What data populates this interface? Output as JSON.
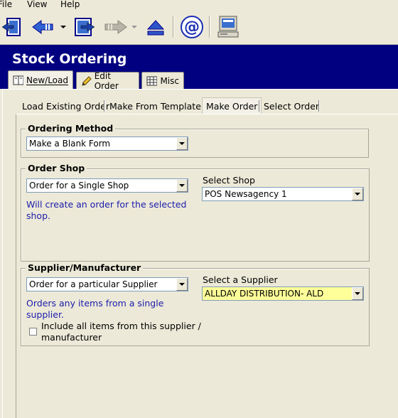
{
  "menu": {
    "file": "File",
    "view": "View",
    "help": "Help"
  },
  "toolbar": {
    "buttons": [
      "exit-icon",
      "back-icon",
      "dropdown-arrow",
      "import-icon",
      "forward-icon",
      "dropdown-arrow",
      "eject-icon",
      "email-icon",
      "computer-icon"
    ]
  },
  "header": {
    "title": "Stock Ordering"
  },
  "outer_tabs": [
    {
      "label": "New/Load",
      "icon": "book-icon",
      "active": true
    },
    {
      "label": "Edit Order",
      "icon": "pencil-icon",
      "active": false
    },
    {
      "label": "Misc",
      "icon": "grid-icon",
      "active": false
    }
  ],
  "sub_tabs": [
    {
      "label": "Load Existing Order",
      "active": false
    },
    {
      "label": "Make From Template",
      "active": false
    },
    {
      "label": "Make Order",
      "active": true
    },
    {
      "label": "Select Order",
      "active": false
    }
  ],
  "ordering_method": {
    "title": "Ordering Method",
    "value": "Make a Blank Form"
  },
  "order_shop": {
    "title": "Order Shop",
    "mode_value": "Order for a Single Shop",
    "hint_line1": "Will create an order for the selected",
    "hint_line2": "shop.",
    "select_label": "Select Shop",
    "shop_value": "POS Newsagency 1"
  },
  "supplier": {
    "title": "Supplier/Manufacturer",
    "mode_value": "Order for a particular Supplier",
    "hint_line1": "Orders any items from a single",
    "hint_line2": "supplier.",
    "select_label": "Select a Supplier",
    "supplier_value": "ALLDAY DISTRIBUTION- ALD",
    "include_all_line1": "Include all items from this supplier /",
    "include_all_line2": "manufacturer",
    "include_all_checked": false
  },
  "colors": {
    "header_bg": "#000080",
    "hint_text": "#1c1cab",
    "supplier_field_bg": "#ffff99"
  }
}
